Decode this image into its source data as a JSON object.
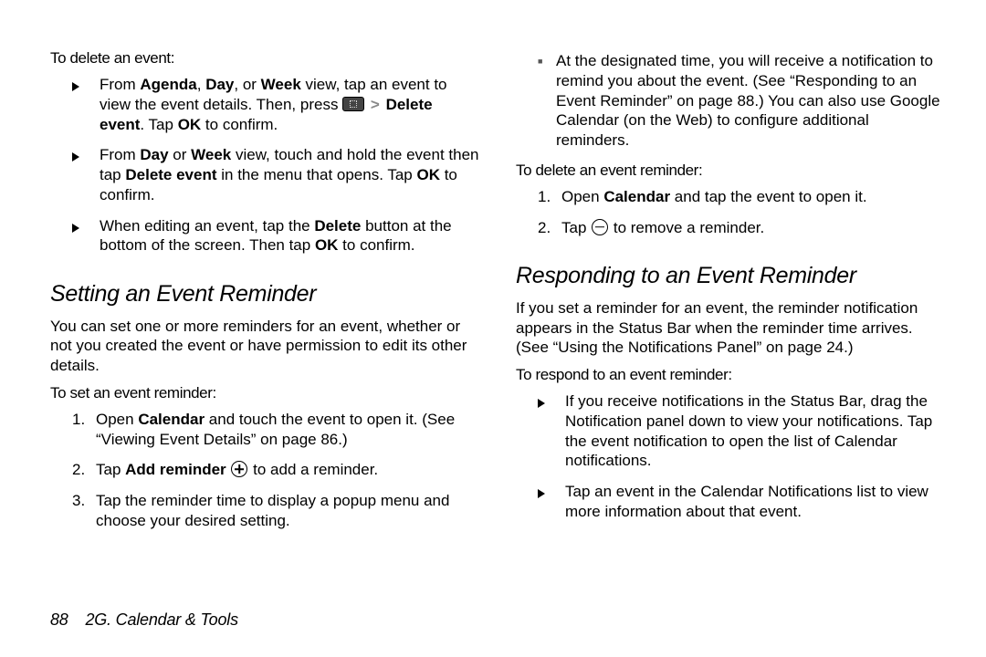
{
  "left": {
    "delete_label": "To delete an event:",
    "del_items": [
      {
        "pre": "From ",
        "b1": "Agenda",
        "mid1": ", ",
        "b2": "Day",
        "mid2": ", or ",
        "b3": "Week",
        "post1": " view, tap an event to view the event details. Then, press ",
        "b4": "Delete event",
        "post2": ". Tap ",
        "b5": "OK",
        "post3": " to confirm."
      },
      {
        "pre": "From ",
        "b1": "Day",
        "mid1": " or ",
        "b2": "Week",
        "post1": " view, touch and hold the event then tap ",
        "b3": "Delete event",
        "post2": " in the menu that opens. Tap ",
        "b4": "OK",
        "post3": " to confirm."
      },
      {
        "pre": "When editing an event, tap the ",
        "b1": "Delete",
        "post1": " button at the bottom of the screen. Then tap ",
        "b2": "OK",
        "post2": " to confirm."
      }
    ],
    "h2": "Setting an Event Reminder",
    "intro": "You can set one or more reminders for an event, whether or not you created the event or have permission to edit its other details.",
    "set_label": "To set an event reminder:",
    "set_items": [
      {
        "num": "1.",
        "pre": "Open ",
        "b1": "Calendar",
        "post1": " and touch the event to open it. (See “Viewing Event Details” on page 86.)"
      },
      {
        "num": "2.",
        "pre": "Tap ",
        "b1": "Add reminder",
        "post1": " to add a reminder."
      },
      {
        "num": "3.",
        "text": "Tap the reminder time to display a popup menu and choose your desired setting."
      }
    ]
  },
  "right": {
    "top_bullet": "At the designated time, you will receive a notification to remind you about the event. (See “Responding to an Event Reminder” on page 88.) You can also use Google Calendar (on the Web) to configure additional reminders.",
    "del_rem_label": "To delete an event reminder:",
    "del_rem_items": [
      {
        "num": "1.",
        "pre": "Open ",
        "b1": "Calendar",
        "post1": " and tap the event to open it."
      },
      {
        "num": "2.",
        "pre": "Tap ",
        "post1": " to remove a reminder."
      }
    ],
    "h2": "Responding to an Event Reminder",
    "intro": "If you set a reminder for an event, the reminder notification appears in the Status Bar when the reminder time arrives. (See “Using the Notifications Panel” on page 24.)",
    "resp_label": "To respond to an event reminder:",
    "resp_items": [
      "If you receive notifications in the Status Bar, drag the Notification panel down to view your notifications. Tap the event notification to open the list of Calendar notifications.",
      "Tap an event in the Calendar Notifications list to view more information about that event."
    ]
  },
  "footer": {
    "page": "88",
    "section": "2G. Calendar & Tools"
  }
}
